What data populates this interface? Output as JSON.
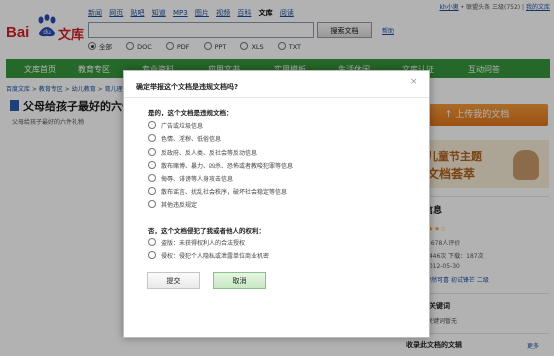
{
  "header": {
    "nav": [
      "新闻",
      "网页",
      "贴吧",
      "知道",
      "MP3",
      "图片",
      "视频",
      "百科",
      "文库",
      "阅读"
    ],
    "active_nav": "文库",
    "user": "kh小崽",
    "user_status": "• 联盟头条 三级(752) |",
    "my_wenku": "我的文库",
    "logo_bai": "Bai",
    "logo_wenku": "文库"
  },
  "search": {
    "value": "",
    "button": "搜索文档",
    "help": "帮助",
    "filetypes": [
      "全部",
      "DOC",
      "PDF",
      "PPT",
      "XLS",
      "TXT"
    ],
    "selected": "全部"
  },
  "channels": [
    "文库首页",
    "教育专区",
    "专业资料",
    "应用文书",
    "实用模板",
    "生活休闲",
    "文库认证",
    "互动问答"
  ],
  "breadcrumb": {
    "prefix": "百度文库",
    "items": [
      "教育专区",
      "幼儿教育",
      "育儿理论经验"
    ]
  },
  "document": {
    "title": "父母给孩子最好的六件礼物",
    "subtitle": "父母给孩子最好的六件礼物"
  },
  "sidebar": {
    "upload": "上传我的文档",
    "banner_line1": "儿童节主题",
    "banner_line2": "文档荟萃",
    "docinfo_title": "文档信息",
    "stars": "★★★★☆",
    "rating_count": "4678人评价",
    "stats": "9446次 下载：187次",
    "date": "2012-05-30",
    "tags": "伊然可喜 初试锋芒 二级",
    "keywords_title": "文档关键词",
    "keywords_text": "文档关键词暂无",
    "fav_title": "收录此文档的文辑",
    "more": "更多"
  },
  "modal": {
    "title": "确定举报这个文档是违规文档吗?",
    "close": "×",
    "q1": "是的，这个文档是违规文档：",
    "q1_options": [
      "广告或垃圾信息",
      "色情、淫秽、低俗信息",
      "反政府、反人类、反社会等反动信息",
      "散布赌博、暴力、凶杀、恐怖或者教唆犯罪等信息",
      "侮辱、诽谤等人身攻击信息",
      "散布谣言、扰乱社会秩序，破坏社会稳定等信息",
      "其他违反规定"
    ],
    "q2": "否，这个文档侵犯了我或者他人的权利：",
    "q2_options": [
      "盗版：未获得权利人的合法授权",
      "侵权：侵犯个人隐私或泄露单位商业机密"
    ],
    "submit": "提交",
    "cancel": "取消"
  }
}
